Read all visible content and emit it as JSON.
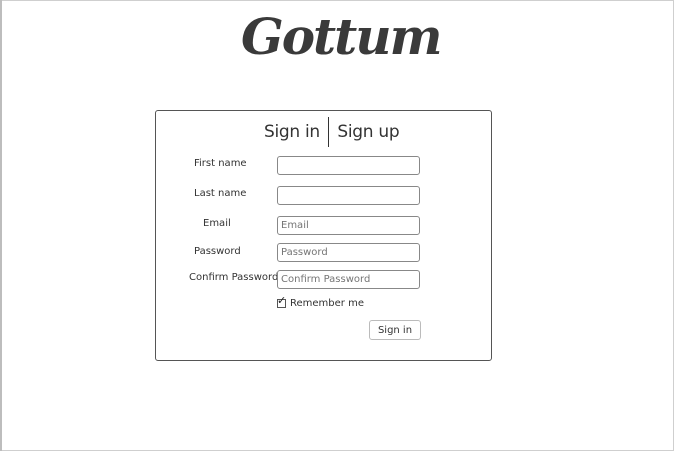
{
  "app": {
    "logo": "Gottum"
  },
  "tabs": {
    "sign_in": "Sign in",
    "sign_up": "Sign up"
  },
  "form": {
    "first_name": {
      "label": "First name",
      "value": "",
      "placeholder": ""
    },
    "last_name": {
      "label": "Last name",
      "value": "",
      "placeholder": ""
    },
    "email": {
      "label": "Email",
      "value": "",
      "placeholder": "Email"
    },
    "password": {
      "label": "Password",
      "value": "",
      "placeholder": "Password"
    },
    "confirm_password": {
      "label": "Confirm Password",
      "value": "",
      "placeholder": "Confirm Password"
    },
    "remember_me": {
      "label": "Remember me",
      "checked": true
    },
    "submit_label": "Sign in"
  }
}
